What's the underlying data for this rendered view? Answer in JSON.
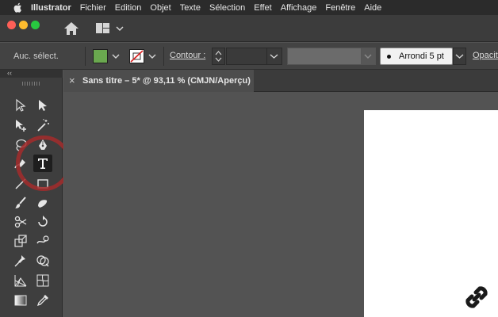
{
  "menubar": {
    "app_name": "Illustrator",
    "items": [
      "Fichier",
      "Edition",
      "Objet",
      "Texte",
      "Sélection",
      "Effet",
      "Affichage",
      "Fenêtre",
      "Aide"
    ]
  },
  "controlbar": {
    "selection_label": "Auc. sélect.",
    "contour_label": "Contour :",
    "brush_value": "Arrondi 5 pt",
    "opacity_label": "Opacit"
  },
  "tools_panel": {
    "collapse_glyph": "‹‹"
  },
  "document": {
    "close_glyph": "×",
    "tab_title": "Sans titre – 5* @ 93,11 % (CMJN/Aperçu)"
  },
  "colors": {
    "fill": "#6aa84f",
    "highlight_ring": "#a32b2b",
    "artboard": "#ffffff",
    "canvas": "#535353"
  },
  "icons": [
    "apple-icon",
    "home-icon",
    "workspace-switcher-icon",
    "selection-tool-icon",
    "direct-selection-tool-icon",
    "anchor-point-tool-icon",
    "magic-wand-tool-icon",
    "lasso-tool-icon",
    "pen-tool-icon",
    "shaper-tool-icon",
    "type-tool-icon",
    "line-tool-icon",
    "rectangle-tool-icon",
    "paintbrush-tool-icon",
    "blob-brush-tool-icon",
    "scissors-tool-icon",
    "rotate-tool-icon",
    "scale-tool-icon",
    "warp-tool-icon",
    "puppet-warp-tool-icon",
    "shape-builder-tool-icon",
    "perspective-grid-tool-icon",
    "mesh-tool-icon",
    "gradient-tool-icon",
    "eyedropper-tool-icon",
    "link-icon"
  ]
}
